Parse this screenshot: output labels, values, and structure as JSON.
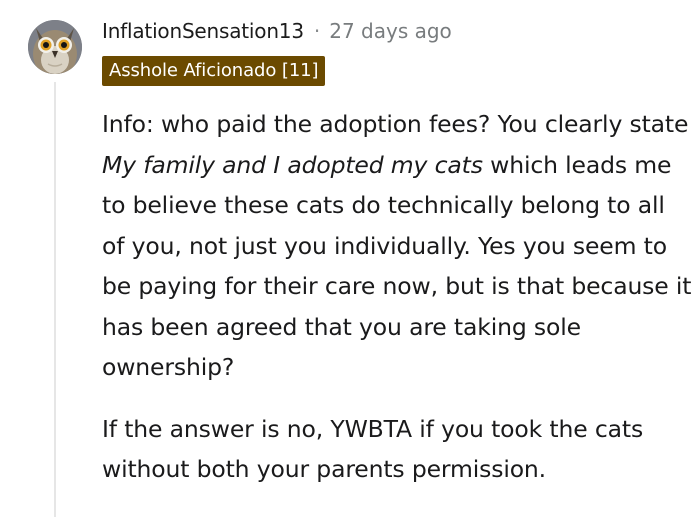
{
  "comment": {
    "username": "InflationSensation13",
    "separator": "·",
    "timestamp": "27 days ago",
    "flair": "Asshole Aficionado [11]",
    "flair_color": "#6b4a00",
    "avatar_icon": "owl-avatar-icon",
    "paragraphs": [
      {
        "before": "Info: who paid the adoption fees? You clearly state ",
        "emphasis": "My family and I adopted my cats",
        "after": " which leads me to believe these cats do technically belong to all of you, not just you individually. Yes you seem to be paying for their care now, but is that because it has been agreed that you are taking sole ownership?"
      },
      {
        "text": "If the answer is no, YWBTA if you took the cats without both your parents permission."
      }
    ]
  }
}
